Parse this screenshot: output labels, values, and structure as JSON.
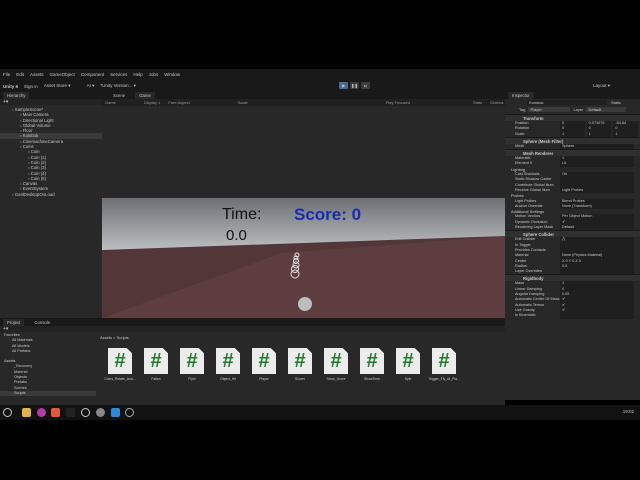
{
  "menu": [
    "File",
    "Edit",
    "Assets",
    "GameObject",
    "Component",
    "Services",
    "Help",
    "Jobs",
    "Window"
  ],
  "toolbar": {
    "account": "Unity 6",
    "sign_in": "Sign in",
    "asset_store": "Asset Store ▾",
    "ai": "AI ▾",
    "version": "*Unity Version... ▾",
    "layout": "Layout ▾"
  },
  "hierarchy": {
    "tab": "Hierarchy",
    "items": [
      {
        "label": "SampleScene*",
        "depth": 0
      },
      {
        "label": "Main Camera",
        "depth": 1
      },
      {
        "label": "Directional Light",
        "depth": 1
      },
      {
        "label": "Global Volume",
        "depth": 1
      },
      {
        "label": "Floor",
        "depth": 1
      },
      {
        "label": "Kolobok",
        "depth": 1,
        "selected": true
      },
      {
        "label": "CinemachineCamera",
        "depth": 1
      },
      {
        "label": "Coins",
        "depth": 1
      },
      {
        "label": "Coin",
        "depth": 2
      },
      {
        "label": "Coin (1)",
        "depth": 2
      },
      {
        "label": "Coin (2)",
        "depth": 2
      },
      {
        "label": "Coin (3)",
        "depth": 2
      },
      {
        "label": "Coin (4)",
        "depth": 2
      },
      {
        "label": "Coin (5)",
        "depth": 2
      },
      {
        "label": "Canvas",
        "depth": 1
      },
      {
        "label": "EventSystem",
        "depth": 1
      },
      {
        "label": "GoslDesktopOnLoad",
        "depth": 0
      }
    ]
  },
  "game": {
    "tabs": [
      "Scene",
      "Game"
    ],
    "mode": "Game",
    "display": "Display 1",
    "aspect": "Free Aspect",
    "scale": "Scale",
    "play_focused": "Play Focused",
    "stats": "Stats",
    "gizmos": "Gizmos",
    "time_label": "Time:",
    "time_value": "0.0",
    "score_label": "Score: 0"
  },
  "inspector": {
    "tab": "Inspector",
    "object": "Kolobok",
    "static": "Static",
    "tag_label": "Tag",
    "tag": "Player",
    "layer_label": "Layer",
    "layer": "Default",
    "transform": {
      "title": "Transform",
      "rows": [
        {
          "label": "Position",
          "x": "0",
          "y": "0.071076",
          "z": "-84.84"
        },
        {
          "label": "Rotation",
          "x": "0",
          "y": "0",
          "z": "0"
        },
        {
          "label": "Scale",
          "x": "1",
          "y": "1",
          "z": "1"
        }
      ]
    },
    "mesh_filter": {
      "title": "Sphere (Mesh Filter)",
      "mesh_label": "Mesh",
      "mesh": "Sphere"
    },
    "mesh_renderer": {
      "title": "Mesh Renderer",
      "materials": "Materials",
      "count": "1",
      "element": "Element 0",
      "element_value": "Lit"
    },
    "lighting": [
      {
        "section": "Lighting"
      },
      {
        "label": "Cast Shadows",
        "value": "On"
      },
      {
        "label": "Static Shadow Caster",
        "value": ""
      },
      {
        "label": "Contribute Global Illum",
        "value": ""
      },
      {
        "label": "Receive Global Illum",
        "value": "Light Probes"
      },
      {
        "section": "Probes"
      },
      {
        "label": "Light Probes",
        "value": "Blend Probes"
      },
      {
        "label": "Anchor Override",
        "value": "None (Transform)"
      },
      {
        "section": "Additional Settings"
      },
      {
        "label": "Motion Vectors",
        "value": "Per Object Motion"
      },
      {
        "label": "Dynamic Occlusion",
        "value": "✔"
      },
      {
        "label": "Rendering Layer Mask",
        "value": "Default"
      }
    ],
    "collider": {
      "title": "Sphere Collider",
      "rows": [
        {
          "label": "Edit Collider",
          "value": "⋀"
        },
        {
          "label": "Is Trigger",
          "value": ""
        },
        {
          "label": "Provides Contacts",
          "value": ""
        },
        {
          "label": "Material",
          "value": "None (Physics Material)"
        },
        {
          "label": "Center",
          "value": "X 0    Y 0    Z 0"
        },
        {
          "label": "Radius",
          "value": "0.5"
        },
        {
          "label": "Layer Overrides",
          "value": ""
        }
      ]
    },
    "rigidbody": {
      "title": "Rigidbody",
      "rows": [
        {
          "label": "Mass",
          "value": "1"
        },
        {
          "label": "Linear Damping",
          "value": "0"
        },
        {
          "label": "Angular Damping",
          "value": "0.05"
        },
        {
          "label": "Automatic Center Of Mass",
          "value": "✔"
        },
        {
          "label": "Automatic Tensor",
          "value": "✔"
        },
        {
          "label": "Use Gravity",
          "value": "✔"
        },
        {
          "label": "Is Kinematic",
          "value": ""
        }
      ]
    }
  },
  "project": {
    "tabs": [
      "Project",
      "Console"
    ],
    "favorites": "Favorites",
    "fav_items": [
      "All Materials",
      "All Models",
      "All Prefabs"
    ],
    "assets": "Assets",
    "folders": [
      "_Recovery",
      "Material",
      "Objects",
      "Prefabs",
      "Scenes",
      "Scripts"
    ],
    "breadcrumb": "Assets > Scripts",
    "files": [
      "Coins_Rotate_And...",
      "Fallen",
      "Flyhl",
      "Object_Hit",
      "Player",
      "Scorer",
      "Show_Score",
      "ShowTime",
      "Spin",
      "Trigger_Fly_At_Pla..."
    ]
  },
  "taskbar": {
    "clock": "19:02",
    "tray_count": "3"
  }
}
